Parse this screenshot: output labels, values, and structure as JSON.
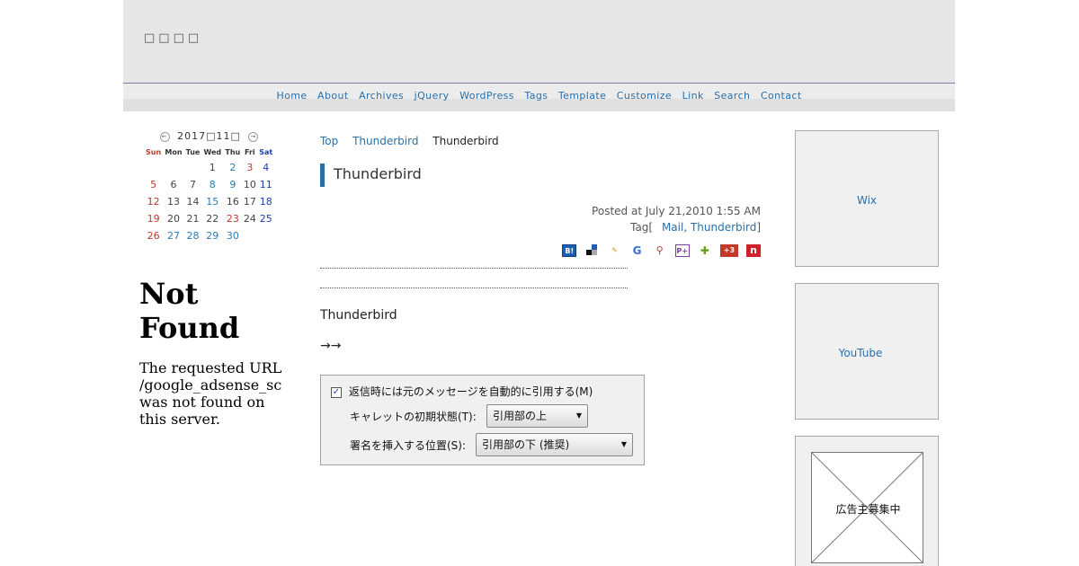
{
  "header": {
    "site_title": "□□□□"
  },
  "nav": [
    "Home",
    "About",
    "Archives",
    "jQuery",
    "WordPress",
    "Tags",
    "Template",
    "Customize",
    "Link",
    "Search",
    "Contact"
  ],
  "calendar": {
    "title": "2017□11□",
    "weekdays": [
      "Sun",
      "Mon",
      "Tue",
      "Wed",
      "Thu",
      "Fri",
      "Sat"
    ],
    "weeks": [
      [
        "",
        "",
        "",
        "1",
        "2",
        "3",
        "4"
      ],
      [
        "5",
        "6",
        "7",
        "8",
        "9",
        "10",
        "11"
      ],
      [
        "12",
        "13",
        "14",
        "15",
        "16",
        "17",
        "18"
      ],
      [
        "19",
        "20",
        "21",
        "22",
        "23",
        "24",
        "25"
      ],
      [
        "26",
        "27",
        "28",
        "29",
        "30",
        "",
        ""
      ]
    ]
  },
  "not_found": {
    "heading": "Not Found",
    "message": "The requested URL\n/google_adsense_sc\nwas not found on\nthis server."
  },
  "breadcrumb": {
    "top": "Top",
    "category": "Thunderbird",
    "current": "Thunderbird"
  },
  "post": {
    "title": "Thunderbird",
    "posted": "Posted at July 21,2010 1:55 AM",
    "tag_prefix": "Tag[",
    "tags": "Mail, Thunderbird",
    "tag_suffix": "]",
    "body": "Thunderbird",
    "arrows": "→→"
  },
  "dialog": {
    "checkbox_label": "返信時には元のメッセージを自動的に引用する(M)",
    "caret_label": "キャレットの初期状態(T):",
    "caret_value": "引用部の上",
    "sig_label": "署名を挿入する位置(S):",
    "sig_value": "引用部の下 (推奨)"
  },
  "sidebar": {
    "box1": "Wix",
    "box2": "YouTube",
    "ad": "広告主募集中"
  }
}
